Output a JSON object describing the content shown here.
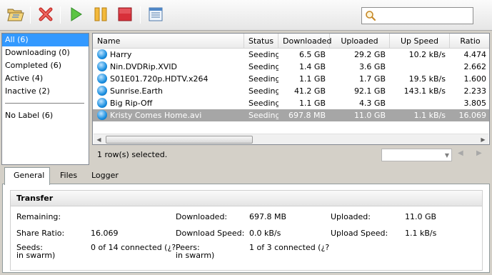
{
  "toolbar": {
    "buttons": [
      {
        "name": "open-torrent-button",
        "icon": "folder-open-icon"
      },
      {
        "name": "remove-button",
        "icon": "remove-x-icon"
      },
      {
        "name": "start-button",
        "icon": "play-icon"
      },
      {
        "name": "pause-button",
        "icon": "pause-icon"
      },
      {
        "name": "stop-button",
        "icon": "stop-icon"
      },
      {
        "name": "preferences-button",
        "icon": "preferences-icon"
      }
    ],
    "search": {
      "value": "",
      "placeholder": ""
    }
  },
  "sidebar": {
    "items": [
      {
        "label": "All (6)",
        "selected": true
      },
      {
        "label": "Downloading (0)"
      },
      {
        "label": "Completed (6)"
      },
      {
        "label": "Active (4)"
      },
      {
        "label": "Inactive (2)"
      }
    ],
    "labels": [
      {
        "label": "No Label (6)"
      }
    ]
  },
  "torrents": {
    "columns": [
      "Name",
      "Status",
      "Downloaded",
      "Uploaded",
      "Up Speed",
      "Ratio"
    ],
    "rows": [
      {
        "name": "Harry",
        "status": "Seeding",
        "downloaded": "6.5 GB",
        "uploaded": "29.2 GB",
        "up_speed": "10.2 kB/s",
        "ratio": "4.474"
      },
      {
        "name": "Nin.DVDRip.XVID",
        "status": "Seeding",
        "downloaded": "1.4 GB",
        "uploaded": "3.6 GB",
        "up_speed": "",
        "ratio": "2.662"
      },
      {
        "name": "S01E01.720p.HDTV.x264",
        "status": "Seeding",
        "downloaded": "1.1 GB",
        "uploaded": "1.7 GB",
        "up_speed": "19.5 kB/s",
        "ratio": "1.600"
      },
      {
        "name": "Sunrise.Earth",
        "status": "Seeding",
        "downloaded": "41.2 GB",
        "uploaded": "92.1 GB",
        "up_speed": "143.1 kB/s",
        "ratio": "2.233"
      },
      {
        "name": "Big Rip-Off",
        "status": "Seeding",
        "downloaded": "1.1 GB",
        "uploaded": "4.3 GB",
        "up_speed": "",
        "ratio": "3.805"
      },
      {
        "name": "Kristy Comes Home.avi",
        "status": "Seeding",
        "downloaded": "697.8 MB",
        "uploaded": "11.0 GB",
        "up_speed": "1.1 kB/s",
        "ratio": "16.069",
        "selected": true
      }
    ]
  },
  "statusbar": {
    "text": "1 row(s) selected.",
    "combo_value": ""
  },
  "tabs": [
    {
      "label": "General",
      "active": true
    },
    {
      "label": "Files"
    },
    {
      "label": "Logger"
    }
  ],
  "details": {
    "group_title": "Transfer",
    "remaining": {
      "label": "Remaining:",
      "value": ""
    },
    "share_ratio": {
      "label": "Share Ratio:",
      "value": "16.069"
    },
    "seeds": {
      "label": "Seeds:",
      "sublabel": "in swarm)",
      "value": "0 of 14 connected (¿?"
    },
    "downloaded": {
      "label": "Downloaded:",
      "value": "697.8 MB"
    },
    "download_speed": {
      "label": "Download Speed:",
      "value": "0.0 kB/s"
    },
    "peers": {
      "label": "Peers:",
      "sublabel": "in swarm)",
      "value": "1 of 3 connected (¿?"
    },
    "uploaded": {
      "label": "Uploaded:",
      "value": "11.0 GB"
    },
    "upload_speed": {
      "label": "Upload Speed:",
      "value": "1.1 kB/s"
    }
  },
  "colors": {
    "selection": "#3399ff",
    "selected_row": "#a6a6a6",
    "seed_icon": "#1a8fe0"
  }
}
